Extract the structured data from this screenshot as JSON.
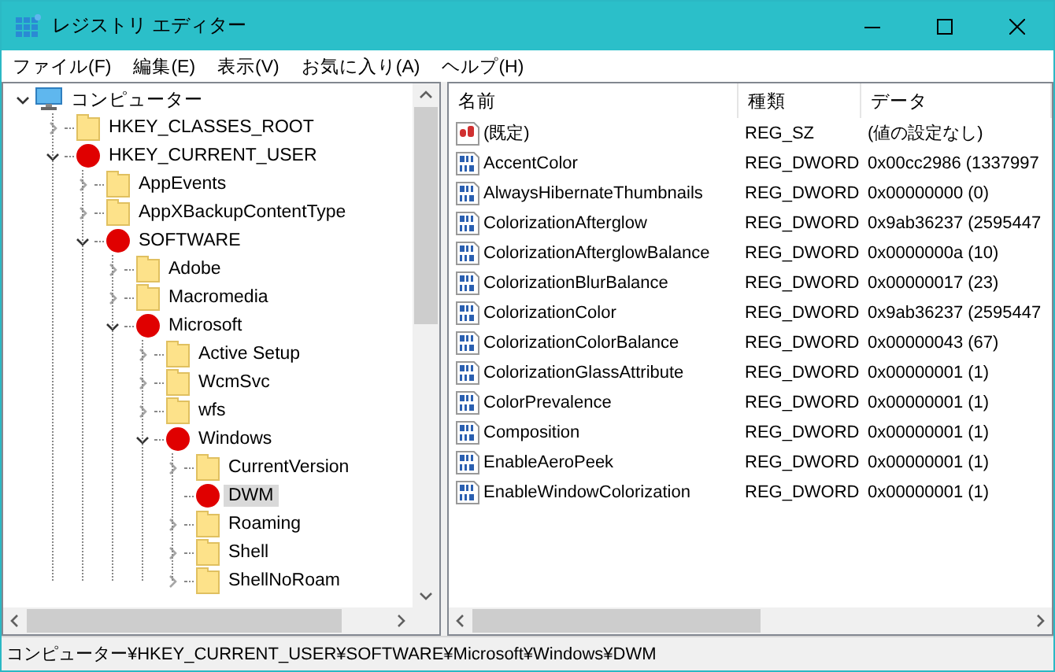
{
  "window": {
    "title": "レジストリ エディター"
  },
  "menu": [
    "ファイル(F)",
    "編集(E)",
    "表示(V)",
    "お気に入り(A)",
    "ヘルプ(H)"
  ],
  "tree": [
    {
      "label": "コンピューター",
      "kind": "computer",
      "expanded": true,
      "selected": false,
      "children": [
        {
          "label": "HKEY_CLASSES_ROOT",
          "expanded": false,
          "marked": false,
          "selected": false
        },
        {
          "label": "HKEY_CURRENT_USER",
          "expanded": true,
          "marked": true,
          "selected": false,
          "children": [
            {
              "label": "AppEvents",
              "expanded": false,
              "marked": false,
              "selected": false
            },
            {
              "label": "AppXBackupContentType",
              "expanded": false,
              "marked": false,
              "selected": false
            },
            {
              "label": "SOFTWARE",
              "expanded": true,
              "marked": true,
              "selected": false,
              "children": [
                {
                  "label": "Adobe",
                  "expanded": false,
                  "marked": false,
                  "selected": false
                },
                {
                  "label": "Macromedia",
                  "expanded": false,
                  "marked": false,
                  "selected": false
                },
                {
                  "label": "Microsoft",
                  "expanded": true,
                  "marked": true,
                  "selected": false,
                  "children": [
                    {
                      "label": "Active Setup",
                      "expanded": false,
                      "marked": false,
                      "selected": false
                    },
                    {
                      "label": "WcmSvc",
                      "expanded": false,
                      "marked": false,
                      "selected": false
                    },
                    {
                      "label": "wfs",
                      "expanded": false,
                      "marked": false,
                      "selected": false
                    },
                    {
                      "label": "Windows",
                      "expanded": true,
                      "marked": true,
                      "selected": false,
                      "children": [
                        {
                          "label": "CurrentVersion",
                          "expanded": false,
                          "marked": false,
                          "selected": false
                        },
                        {
                          "label": "DWM",
                          "marked": true,
                          "selected": true
                        },
                        {
                          "label": "Roaming",
                          "expanded": false,
                          "marked": false,
                          "selected": false
                        },
                        {
                          "label": "Shell",
                          "expanded": false,
                          "marked": false,
                          "selected": false
                        },
                        {
                          "label": "ShellNoRoam",
                          "expanded": false,
                          "marked": false,
                          "selected": false
                        }
                      ]
                    }
                  ]
                }
              ]
            }
          ]
        }
      ]
    }
  ],
  "table": {
    "columns": [
      "名前",
      "種類",
      "データ"
    ],
    "rows": [
      {
        "kind": "string",
        "name": "(既定)",
        "type": "REG_SZ",
        "data": "(値の設定なし)"
      },
      {
        "kind": "dword",
        "name": "AccentColor",
        "type": "REG_DWORD",
        "data": "0x00cc2986 (1337997"
      },
      {
        "kind": "dword",
        "name": "AlwaysHibernateThumbnails",
        "type": "REG_DWORD",
        "data": "0x00000000 (0)"
      },
      {
        "kind": "dword",
        "name": "ColorizationAfterglow",
        "type": "REG_DWORD",
        "data": "0x9ab36237 (2595447"
      },
      {
        "kind": "dword",
        "name": "ColorizationAfterglowBalance",
        "type": "REG_DWORD",
        "data": "0x0000000a (10)"
      },
      {
        "kind": "dword",
        "name": "ColorizationBlurBalance",
        "type": "REG_DWORD",
        "data": "0x00000017 (23)"
      },
      {
        "kind": "dword",
        "name": "ColorizationColor",
        "type": "REG_DWORD",
        "data": "0x9ab36237 (2595447"
      },
      {
        "kind": "dword",
        "name": "ColorizationColorBalance",
        "type": "REG_DWORD",
        "data": "0x00000043 (67)"
      },
      {
        "kind": "dword",
        "name": "ColorizationGlassAttribute",
        "type": "REG_DWORD",
        "data": "0x00000001 (1)"
      },
      {
        "kind": "dword",
        "name": "ColorPrevalence",
        "type": "REG_DWORD",
        "data": "0x00000001 (1)"
      },
      {
        "kind": "dword",
        "name": "Composition",
        "type": "REG_DWORD",
        "data": "0x00000001 (1)"
      },
      {
        "kind": "dword",
        "name": "EnableAeroPeek",
        "type": "REG_DWORD",
        "data": "0x00000001 (1)"
      },
      {
        "kind": "dword",
        "name": "EnableWindowColorization",
        "type": "REG_DWORD",
        "data": "0x00000001 (1)"
      }
    ]
  },
  "status_bar": "コンピューター¥HKEY_CURRENT_USER¥SOFTWARE¥Microsoft¥Windows¥DWM"
}
